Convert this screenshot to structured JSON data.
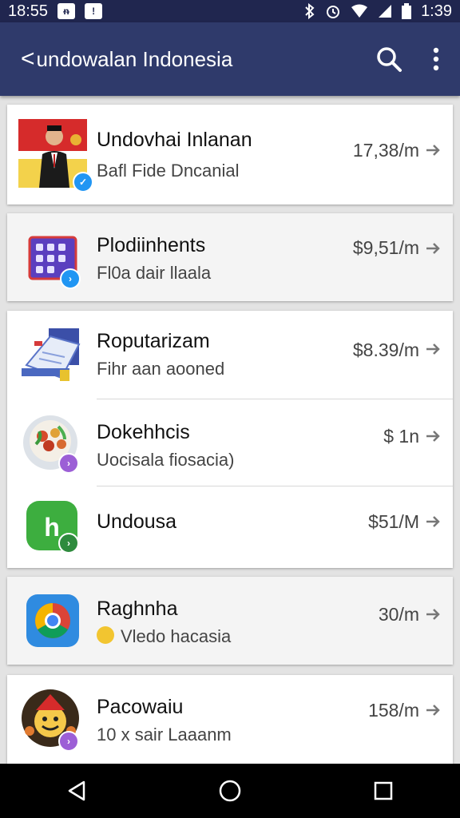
{
  "status_bar": {
    "time_left": "18:55",
    "notif_1": "ᵰ",
    "notif_2": "!",
    "time_right": "1:39",
    "icons": [
      "bluetooth-icon",
      "alarm-icon",
      "wifi-icon",
      "signal-icon",
      "battery-icon"
    ]
  },
  "app_bar": {
    "back_glyph": "<",
    "title": "undowalan Indonesia",
    "actions": [
      "search-icon",
      "more-vert-icon"
    ]
  },
  "items": [
    {
      "name": "Undovhai Inlanan",
      "sub": "Bafl Fide Dncanial",
      "price": "17,38/m",
      "badge_color": "#2196f3"
    },
    {
      "name": "Plodiinhents",
      "sub": "Fl0a dair llaala",
      "price": "$9,51/m",
      "badge_color": "#2196f3"
    },
    {
      "name": "Roputarizam",
      "sub": "Fihr aan aooned",
      "price": "$8.39/m",
      "badge_color": ""
    },
    {
      "name": "Dokehhcis",
      "sub": "Uocisala fiosacia)",
      "price": "$ 1n",
      "badge_color": "#9c5fd6"
    },
    {
      "name": "Undousa",
      "sub": "",
      "price": "$51/M",
      "badge_color": "#2e8b3d"
    },
    {
      "name": "Raghnha",
      "sub": "Vledo hacasia",
      "price": "30/m",
      "badge_color": ""
    },
    {
      "name": "Pacowaiu",
      "sub": "10 x sair Laaanm",
      "price": "158/m",
      "badge_color": "#9c5fd6"
    }
  ],
  "nav_bar": {
    "buttons": [
      "back-nav-icon",
      "home-nav-icon",
      "recents-nav-icon"
    ]
  }
}
